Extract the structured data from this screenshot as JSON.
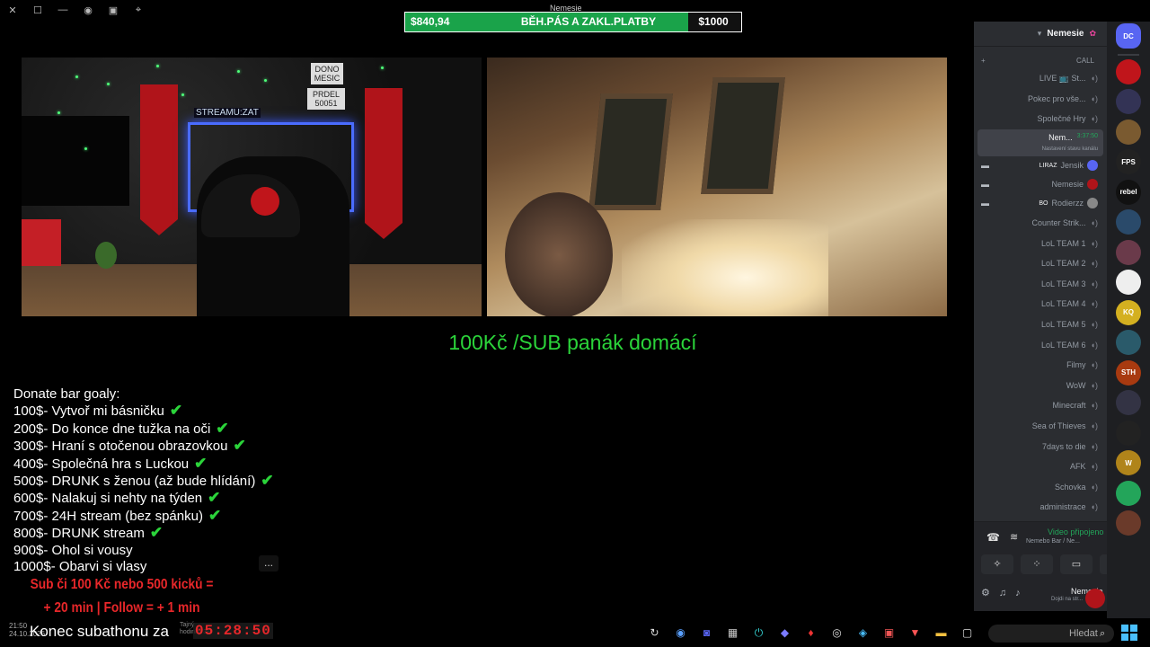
{
  "window_controls": [
    "✕",
    "☐",
    "—"
  ],
  "top_app_name": "Nemesie",
  "goal": {
    "current": "$840,94",
    "label": "BĚH.PÁS A ZAKL.PLATBY",
    "target": "$1000",
    "progress_percent": 84.1,
    "fill_color": "#1aa34a"
  },
  "cam1": {
    "sign1": "DONO\nMESIC",
    "sign2": "PRDEL\n50051",
    "neon_text": "STREAMU:ZAT"
  },
  "sub_text": "100Kč /SUB panák domácí",
  "donate": {
    "title": "Donate bar goaly:",
    "items": [
      {
        "text": "100$- Vytvoř mi básničku",
        "done": true
      },
      {
        "text": "200$- Do konce dne tužka na oči",
        "done": true
      },
      {
        "text": "300$- Hraní s otočenou obrazovkou",
        "done": true
      },
      {
        "text": "400$- Společná hra s Luckou",
        "done": true
      },
      {
        "text": "500$- DRUNK s ženou (až bude hlídání)",
        "done": true
      },
      {
        "text": "600$- Nalakuj si nehty na týden",
        "done": true
      },
      {
        "text": "700$- 24H stream (bez spánku)",
        "done": true
      },
      {
        "text": "800$-  DRUNK stream",
        "done": true
      },
      {
        "text": "900$- Ohol si vousy",
        "done": false
      },
      {
        "text": "1000$- Obarvi si vlasy",
        "done": false
      }
    ],
    "check_symbol": "✔"
  },
  "red_text": {
    "line1": "Sub či 100 Kč nebo 500 kicků =",
    "line2": "+ 20 min | Follow = + 1 min"
  },
  "more_button": "...",
  "taskbar": {
    "date_time": "21:50\n24.10.2026",
    "title": "Konec subathonu za",
    "small_label": "Tajný\nhodinky 3+",
    "countdown": "05:28:50",
    "search_placeholder": "Hledat",
    "apps": [
      {
        "icon": "refresh-icon",
        "glyph": "↻",
        "color": "#ddd"
      },
      {
        "icon": "steam-icon",
        "glyph": "◉",
        "color": "#5aa0ff"
      },
      {
        "icon": "discord-icon",
        "glyph": "◙",
        "color": "#5865f2"
      },
      {
        "icon": "cpu-icon",
        "glyph": "▦",
        "color": "#ccc"
      },
      {
        "icon": "power-icon",
        "glyph": "⏻",
        "color": "#3cc"
      },
      {
        "icon": "kick-icon",
        "glyph": "◆",
        "color": "#7a7aff"
      },
      {
        "icon": "pin-icon",
        "glyph": "♦",
        "color": "#e33"
      },
      {
        "icon": "obs-icon",
        "glyph": "◎",
        "color": "#ddd"
      },
      {
        "icon": "steam-alt-icon",
        "glyph": "◈",
        "color": "#4ac0ff"
      },
      {
        "icon": "media-icon",
        "glyph": "▣",
        "color": "#e55"
      },
      {
        "icon": "brave-icon",
        "glyph": "▼",
        "color": "#f55"
      },
      {
        "icon": "folder-icon",
        "glyph": "▬",
        "color": "#f4c040"
      },
      {
        "icon": "window-icon",
        "glyph": "▢",
        "color": "#ddd"
      }
    ]
  },
  "discord": {
    "server_name": "Nemesie",
    "category": "CALL",
    "channels": [
      {
        "name": "LIVE 📺 St...",
        "type": "voice"
      },
      {
        "name": "Pokec pro vše...",
        "type": "voice"
      },
      {
        "name": "Společné Hry",
        "type": "voice"
      }
    ],
    "active_channel": {
      "name": "Nem...",
      "time": "3:37:50",
      "status": "Nastavení stavu kanálu"
    },
    "users": [
      {
        "name": "Jensik",
        "tag": "LIRAZ",
        "color": "#5865f2"
      },
      {
        "name": "Nemesie",
        "tag": "",
        "color": "#b0141a"
      },
      {
        "name": "Rodierzz",
        "tag": "BO",
        "color": "#888"
      }
    ],
    "channels2": [
      "Counter Strik...",
      "LoL TEAM 1",
      "LoL TEAM 2",
      "LoL TEAM 3",
      "LoL TEAM 4",
      "LoL TEAM 5",
      "LoL TEAM 6",
      "Filmy",
      "WoW",
      "Minecraft",
      "Sea of Thieves",
      "7days to die",
      "AFK",
      "Schovka",
      "administrace"
    ],
    "voice_status": "Video připojeno",
    "voice_sub": "Nemebo Bar / Ne...",
    "user_name": "Nemesie",
    "user_status": "Dojdi na str..."
  },
  "servers": [
    {
      "icon": "discord-home-icon",
      "label": "DC",
      "color": "#5865f2"
    },
    {
      "icon": "server-red-icon",
      "label": "",
      "color": "#c0151b"
    },
    {
      "icon": "server-ring-icon",
      "label": "",
      "color": "#335"
    },
    {
      "icon": "server-horde-icon",
      "label": "",
      "color": "#7a5a30"
    },
    {
      "icon": "server-fps-icon",
      "label": "FPS",
      "color": "#222"
    },
    {
      "icon": "server-rebel-icon",
      "label": "rebel",
      "color": "#111"
    },
    {
      "icon": "server-hero-icon",
      "label": "",
      "color": "#2a4a6a"
    },
    {
      "icon": "server-girls-icon",
      "label": "",
      "color": "#6a3a4a"
    },
    {
      "icon": "server-yk-icon",
      "label": "",
      "color": "#eee"
    },
    {
      "icon": "server-kq-icon",
      "label": "KQ",
      "color": "#d4b020"
    },
    {
      "icon": "server-wolf-icon",
      "label": "",
      "color": "#2a5a6a"
    },
    {
      "icon": "server-sth-icon",
      "label": "STH",
      "color": "#a83a10"
    },
    {
      "icon": "server-tower-icon",
      "label": "",
      "color": "#334"
    },
    {
      "icon": "server-spiral-icon",
      "label": "",
      "color": "#222"
    },
    {
      "icon": "server-wow-icon",
      "label": "W",
      "color": "#b0841a"
    },
    {
      "icon": "server-green-icon",
      "label": "",
      "color": "#23a55a"
    },
    {
      "icon": "server-face-icon",
      "label": "",
      "color": "#6a3a2a"
    }
  ]
}
